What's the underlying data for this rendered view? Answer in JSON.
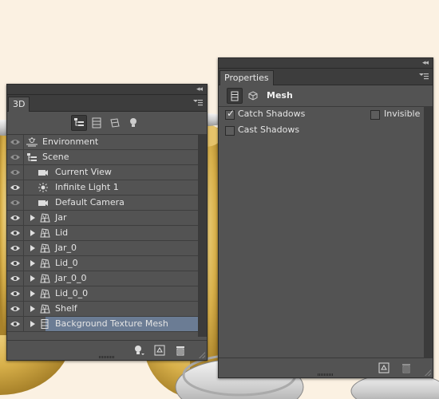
{
  "panel_3d": {
    "tab_label": "3D",
    "collapse_glyph": "◂◂",
    "filter_icons": [
      "scene-filter-icon",
      "mesh-filter-icon",
      "material-filter-icon",
      "light-filter-icon"
    ],
    "rows": [
      {
        "label": "Environment",
        "icon": "environment-icon",
        "indent": 0,
        "expandable": false,
        "eye": "dim"
      },
      {
        "label": "Scene",
        "icon": "scene-icon",
        "indent": 0,
        "expandable": false,
        "eye": "dim"
      },
      {
        "label": "Current View",
        "icon": "camera-icon",
        "indent": 1,
        "expandable": false,
        "eye": "dim"
      },
      {
        "label": "Infinite Light 1",
        "icon": "light-icon",
        "indent": 1,
        "expandable": false,
        "eye": "on"
      },
      {
        "label": "Default Camera",
        "icon": "camera-icon",
        "indent": 1,
        "expandable": false,
        "eye": "dim"
      },
      {
        "label": "Jar",
        "icon": "mesh-icon",
        "indent": 1,
        "expandable": true,
        "eye": "on"
      },
      {
        "label": "Lid",
        "icon": "mesh-icon",
        "indent": 1,
        "expandable": true,
        "eye": "on"
      },
      {
        "label": "Jar_0",
        "icon": "mesh-icon",
        "indent": 1,
        "expandable": true,
        "eye": "on"
      },
      {
        "label": "Lid_0",
        "icon": "mesh-icon",
        "indent": 1,
        "expandable": true,
        "eye": "on"
      },
      {
        "label": "Jar_0_0",
        "icon": "mesh-icon",
        "indent": 1,
        "expandable": true,
        "eye": "on"
      },
      {
        "label": "Lid_0_0",
        "icon": "mesh-icon",
        "indent": 1,
        "expandable": true,
        "eye": "on"
      },
      {
        "label": "Shelf",
        "icon": "mesh-icon",
        "indent": 1,
        "expandable": true,
        "eye": "on"
      },
      {
        "label": "Background Texture Mesh",
        "icon": "mesh-plane-icon",
        "indent": 1,
        "expandable": true,
        "eye": "on",
        "selected": true
      }
    ],
    "footer_icons": [
      "add-light-icon",
      "new-mesh-icon",
      "delete-icon"
    ]
  },
  "properties": {
    "tab_label": "Properties",
    "collapse_glyph": "◂◂",
    "section_title": "Mesh",
    "catch_shadows": {
      "label": "Catch Shadows",
      "checked": true
    },
    "invisible": {
      "label": "Invisible",
      "checked": false
    },
    "cast_shadows": {
      "label": "Cast Shadows",
      "checked": false
    },
    "footer_icons": [
      "new-mesh-icon",
      "delete-icon"
    ]
  },
  "colors": {
    "panel_bg": "#535353",
    "panel_dark": "#3d3d3d",
    "selection": "#6b7c94",
    "canvas_bg": "#fbf1e2"
  }
}
